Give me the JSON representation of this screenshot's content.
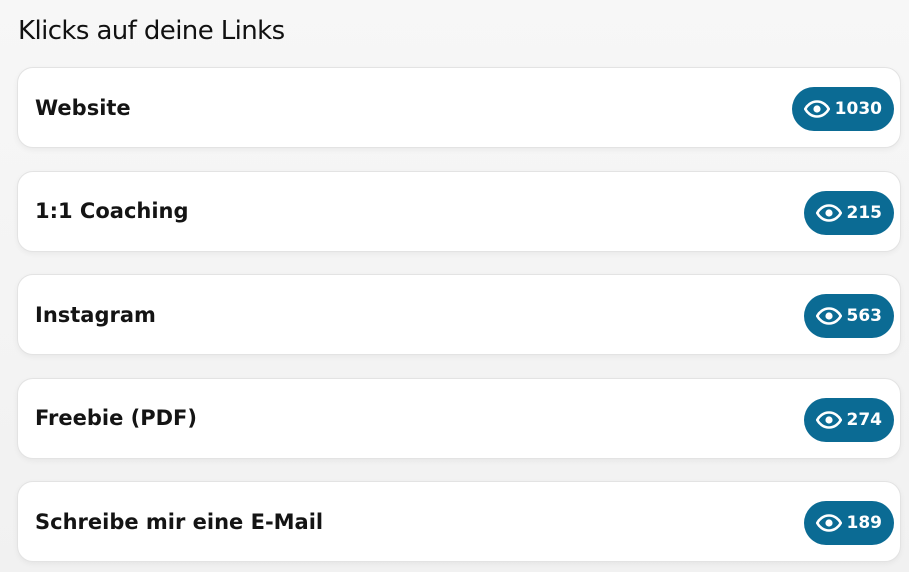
{
  "header": {
    "title": "Klicks auf deine Links"
  },
  "links": [
    {
      "label": "Website",
      "clicks": "1030",
      "icon": "eye-icon"
    },
    {
      "label": "1:1 Coaching",
      "clicks": "215",
      "icon": "eye-icon"
    },
    {
      "label": "Instagram",
      "clicks": "563",
      "icon": "eye-icon"
    },
    {
      "label": "Freebie (PDF)",
      "clicks": "274",
      "icon": "eye-icon"
    },
    {
      "label": "Schreibe mir eine E-Mail",
      "clicks": "189",
      "icon": "eye-icon"
    }
  ],
  "colors": {
    "badge_background": "#0b6b94",
    "badge_text": "#ffffff",
    "card_background": "#ffffff",
    "page_background": "#f3f3f3"
  }
}
